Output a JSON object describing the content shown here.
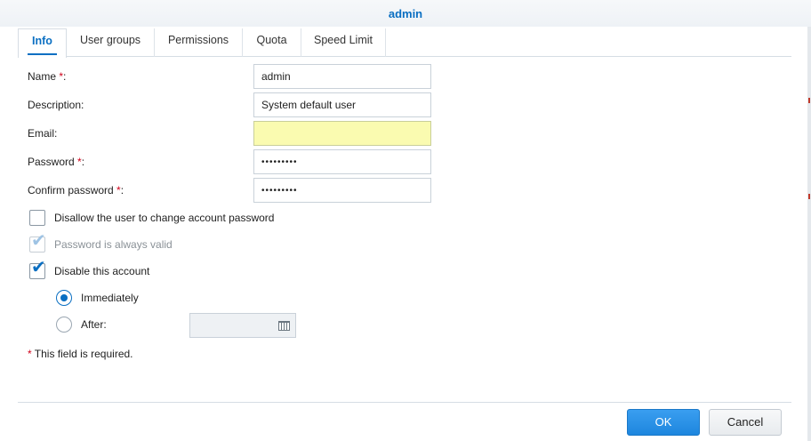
{
  "window": {
    "title": "admin"
  },
  "tabs": [
    {
      "label": "Info",
      "active": true
    },
    {
      "label": "User groups",
      "active": false
    },
    {
      "label": "Permissions",
      "active": false
    },
    {
      "label": "Quota",
      "active": false
    },
    {
      "label": "Speed Limit",
      "active": false
    }
  ],
  "form": {
    "name": {
      "label": "Name",
      "required_mark": "*",
      "suffix": ":",
      "value": "admin"
    },
    "description": {
      "label": "Description:",
      "value": "System default user"
    },
    "email": {
      "label": "Email:",
      "value": ""
    },
    "password": {
      "label": "Password",
      "required_mark": "*",
      "suffix": ":",
      "value": "•••••••••"
    },
    "confirm_password": {
      "label": "Confirm password",
      "required_mark": "*",
      "suffix": ":",
      "value": "•••••••••"
    }
  },
  "options": {
    "disallow_change": {
      "label": "Disallow the user to change account password",
      "checked": false
    },
    "always_valid": {
      "label": "Password is always valid",
      "checked": true,
      "disabled": true
    },
    "disable_account": {
      "label": "Disable this account",
      "checked": true
    },
    "immediately": {
      "label": "Immediately",
      "selected": true
    },
    "after": {
      "label": "After:",
      "selected": false,
      "date_value": ""
    }
  },
  "required_note": {
    "mark": "*",
    "text": " This field is required."
  },
  "buttons": {
    "ok": "OK",
    "cancel": "Cancel"
  },
  "icons": {
    "checkmark": "check-icon",
    "calendar": "calendar-icon"
  },
  "colors": {
    "accent": "#0a6fc2",
    "required": "#d0021b",
    "email_bg": "#fafbb0"
  }
}
